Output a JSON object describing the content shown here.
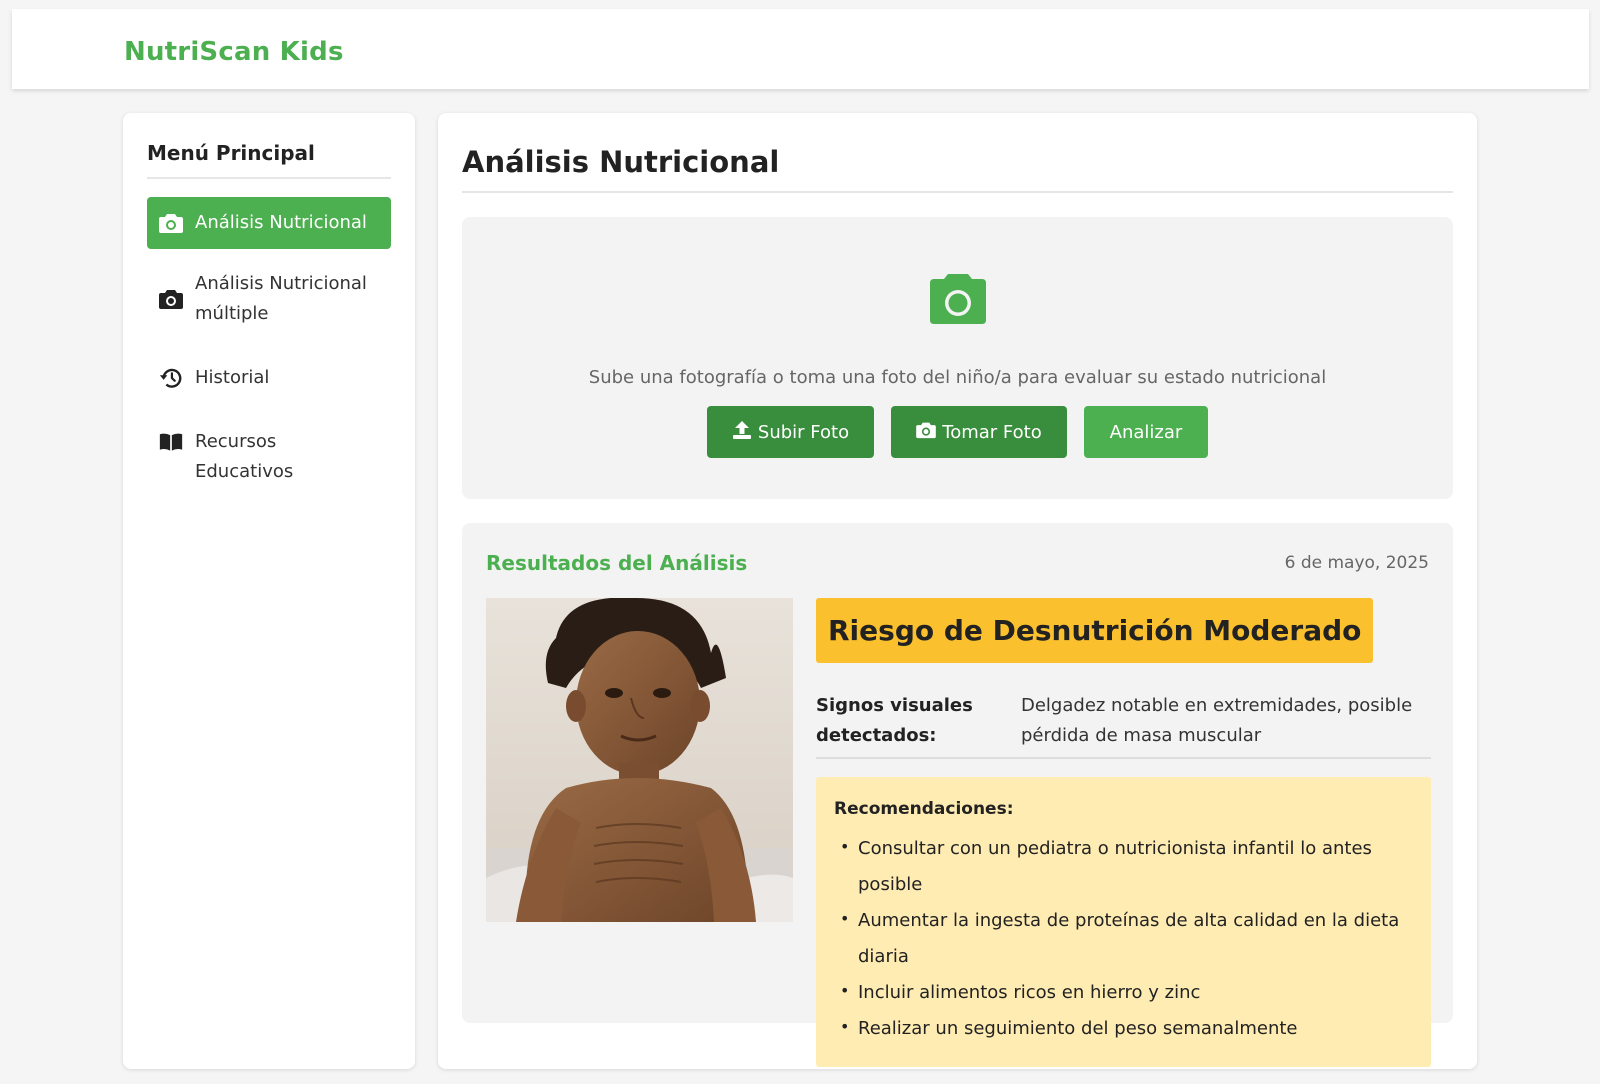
{
  "header": {
    "brand": "NutriScan Kids"
  },
  "sidebar": {
    "title": "Menú Principal",
    "items": [
      {
        "label": "Análisis Nutricional",
        "icon": "camera-icon",
        "active": true
      },
      {
        "label": "Análisis Nutricional múltiple",
        "icon": "camera-icon",
        "active": false
      },
      {
        "label": "Historial",
        "icon": "history-icon",
        "active": false
      },
      {
        "label": "Recursos Educativos",
        "icon": "book-icon",
        "active": false
      }
    ]
  },
  "main": {
    "title": "Análisis Nutricional",
    "upload": {
      "icon": "camera-icon",
      "text": "Sube una fotografía o toma una foto del niño/a para evaluar su estado nutricional",
      "buttons": {
        "upload": "Subir Foto",
        "take": "Tomar Foto",
        "analyze": "Analizar"
      }
    },
    "results": {
      "title": "Resultados del Análisis",
      "date": "6 de mayo, 2025",
      "risk_label": "Riesgo de Desnutrición Moderado",
      "signs_label": "Signos visuales detectados:",
      "signs_value": "Delgadez notable en extremidades, posible pérdida de masa muscular",
      "recommendations_title": "Recomendaciones:",
      "recommendations": [
        "Consultar con un pediatra o nutricionista infantil lo antes posible",
        "Aumentar la ingesta de proteínas de alta calidad en la dieta diaria",
        "Incluir alimentos ricos en hierro y zinc",
        "Realizar un seguimiento del peso semanalmente"
      ]
    }
  },
  "colors": {
    "brand_green": "#4caf50",
    "dark_green": "#388e3c",
    "risk_yellow": "#fbc02d",
    "recs_bg": "#ffecb3"
  }
}
